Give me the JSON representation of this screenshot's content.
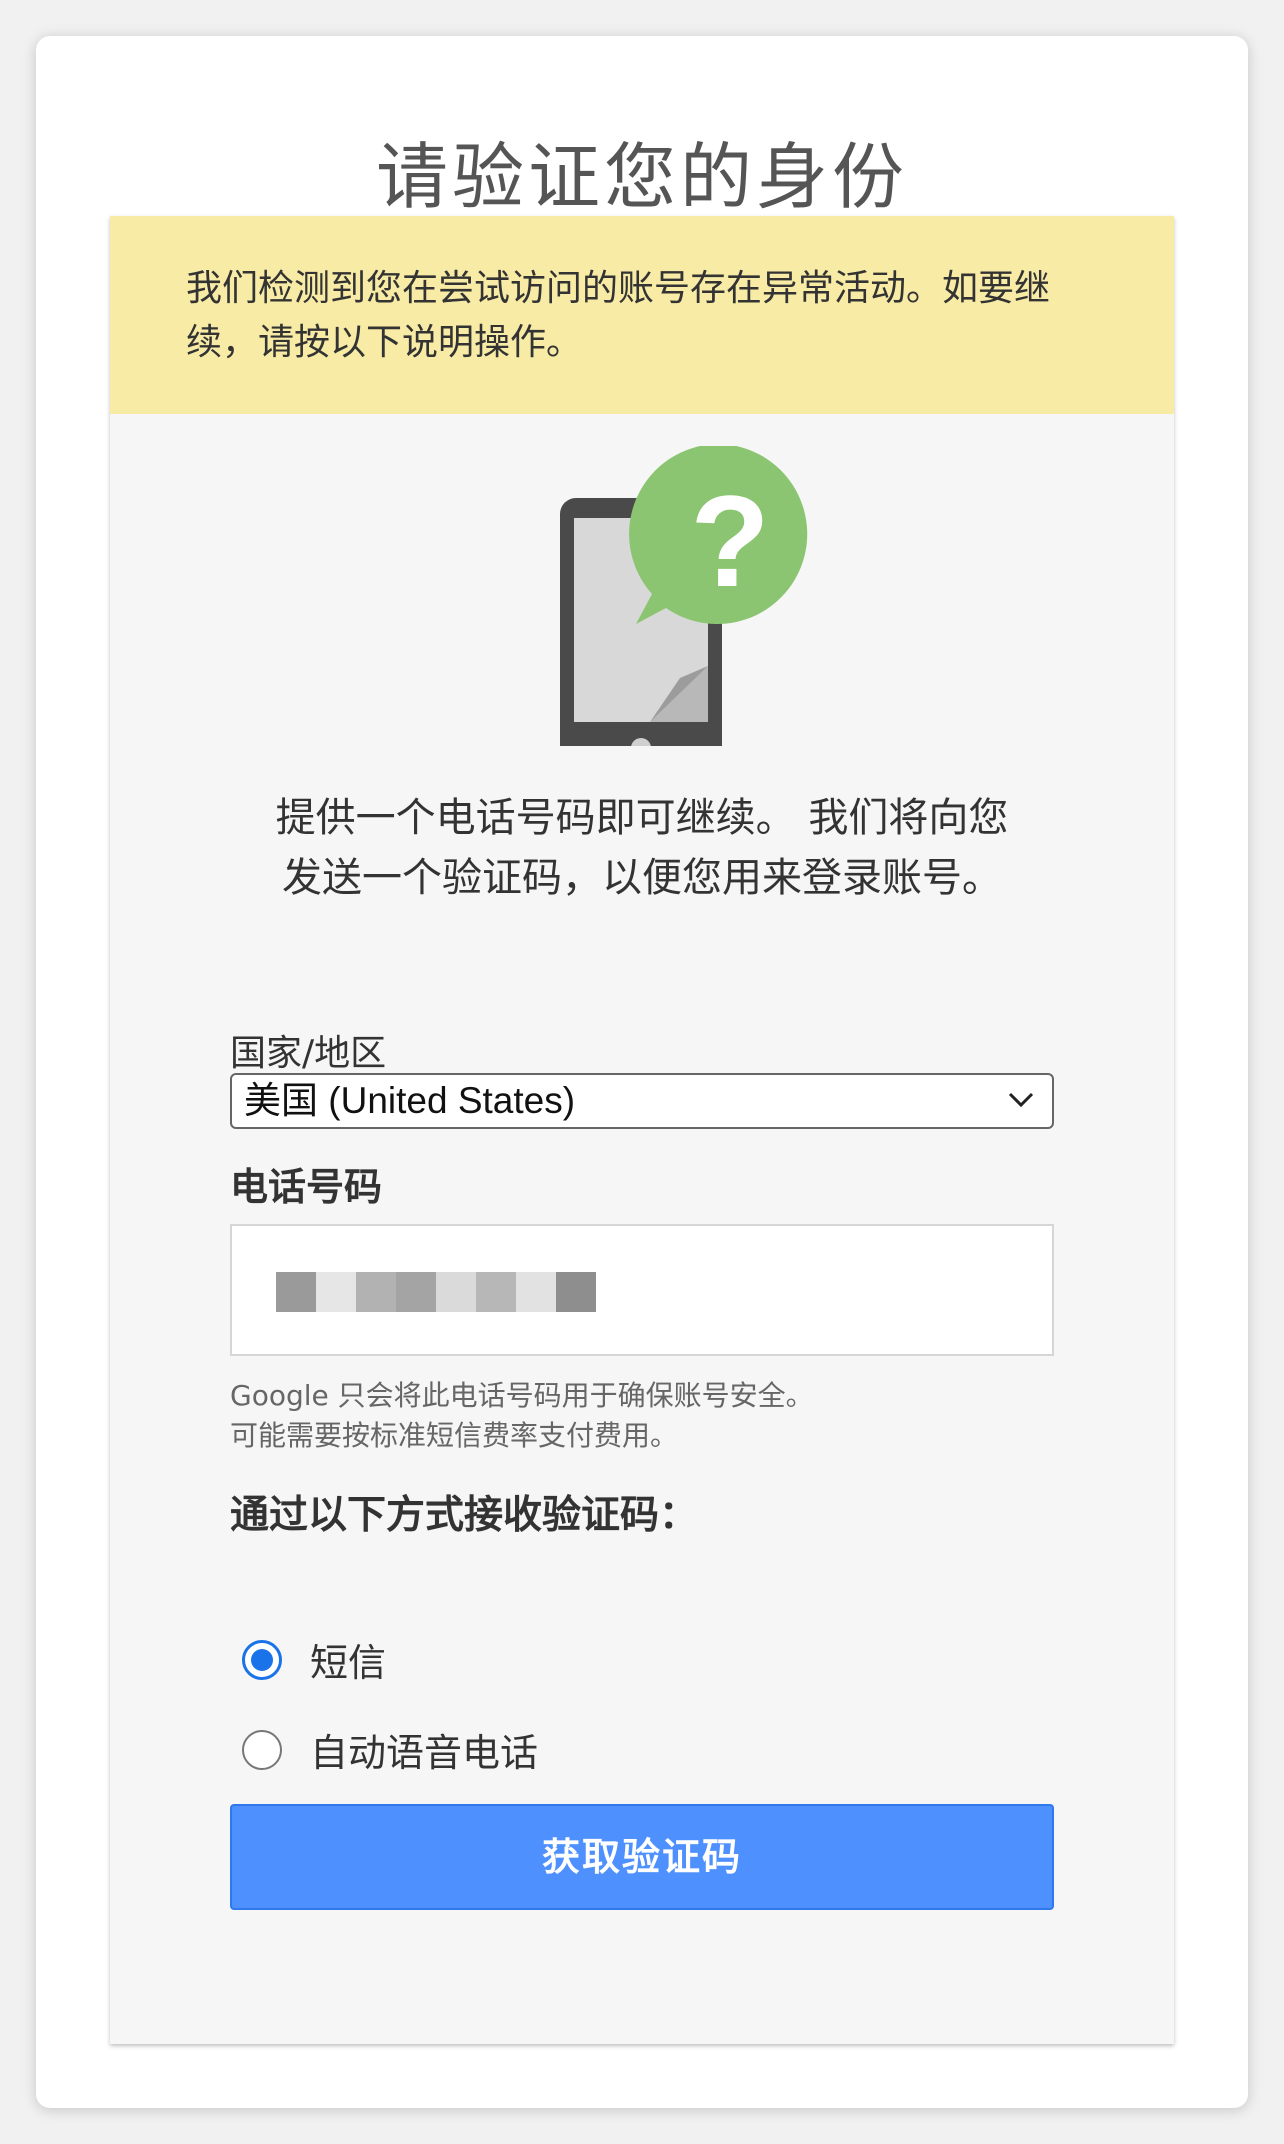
{
  "page": {
    "title": "请验证您的身份"
  },
  "warning": {
    "text": "我们检测到您在尝试访问的账号存在异常活动。如要继续，请按以下说明操作。"
  },
  "illustration": {
    "icon": "phone-question-icon",
    "glyph": "?"
  },
  "intro": {
    "text": "提供一个电话号码即可继续。 我们将向您发送一个验证码，以便您用来登录账号。"
  },
  "country": {
    "label": "国家/地区",
    "selected": "美国 (United States)"
  },
  "phone": {
    "label": "电话号码",
    "hint_line1": "Google 只会将此电话号码用于确保账号安全。",
    "hint_line2": "可能需要按标准短信费率支付费用。"
  },
  "method": {
    "label": "通过以下方式接收验证码：",
    "options": [
      {
        "label": "短信",
        "checked": true
      },
      {
        "label": "自动语音电话",
        "checked": false
      }
    ]
  },
  "submit": {
    "label": "获取验证码"
  },
  "colors": {
    "warning_bg": "#f8eba6",
    "accent": "#1a73e8",
    "button": "#4d90fe",
    "bubble": "#8bc571"
  }
}
